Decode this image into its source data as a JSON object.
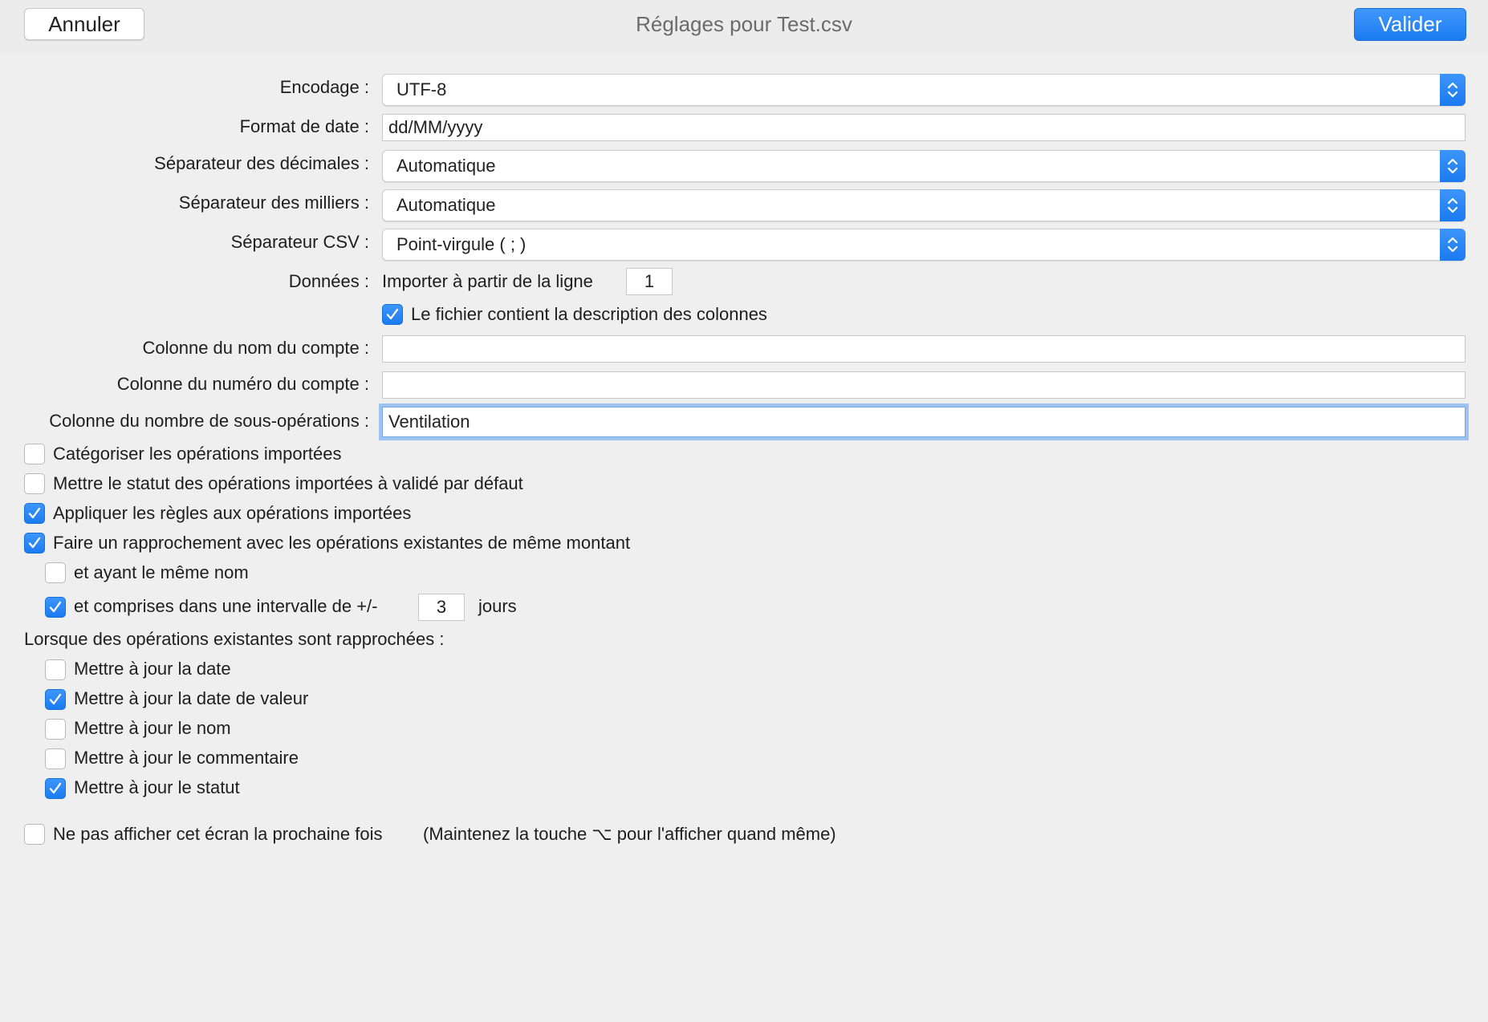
{
  "window": {
    "title": "Réglages pour Test.csv",
    "cancel_label": "Annuler",
    "ok_label": "Valider",
    "accent_color": "#1b7cf0"
  },
  "form": {
    "encoding": {
      "label": "Encodage :",
      "value": "UTF-8"
    },
    "date_format": {
      "label": "Format de date :",
      "value": "dd/MM/yyyy"
    },
    "decimal_separator": {
      "label": "Séparateur des décimales :",
      "value": "Automatique"
    },
    "thousands_separator": {
      "label": "Séparateur des milliers :",
      "value": "Automatique"
    },
    "csv_separator": {
      "label": "Séparateur CSV :",
      "value": "Point-virgule ( ; )"
    },
    "data": {
      "label": "Données :",
      "import_from_text": "Importer à partir de la ligne",
      "import_from_value": "1",
      "header_row_label": "Le fichier contient la description des colonnes",
      "header_row_checked": true
    },
    "account_name_column": {
      "label": "Colonne du nom du compte :",
      "value": ""
    },
    "account_number_column": {
      "label": "Colonne du numéro du compte :",
      "value": ""
    },
    "suboperations_column": {
      "label": "Colonne du nombre de sous-opérations :",
      "value": "Ventilation"
    }
  },
  "options": [
    {
      "label": "Catégoriser les opérations importées",
      "checked": false
    },
    {
      "label": "Mettre le statut des opérations importées à validé par défaut",
      "checked": false
    },
    {
      "label": "Appliquer les règles aux opérations importées",
      "checked": true
    },
    {
      "label": "Faire un rapprochement avec les opérations existantes de même montant",
      "checked": true
    },
    {
      "label": "et ayant le même nom",
      "checked": false
    },
    {
      "label": "et comprises dans une intervalle de +/-",
      "checked": true,
      "days_value": "3",
      "days_unit": "jours"
    }
  ],
  "reconcile": {
    "heading": "Lorsque des opérations existantes sont rapprochées :",
    "items": [
      {
        "label": "Mettre à jour la date",
        "checked": false
      },
      {
        "label": "Mettre à jour la date de valeur",
        "checked": true
      },
      {
        "label": "Mettre à jour le nom",
        "checked": false
      },
      {
        "label": "Mettre à jour le commentaire",
        "checked": false
      },
      {
        "label": "Mettre à jour le statut",
        "checked": true
      }
    ]
  },
  "footer": {
    "dont_show_label": "Ne pas afficher cet écran la prochaine fois",
    "dont_show_checked": false,
    "hint": "(Maintenez la touche ⌥ pour l'afficher quand même)"
  }
}
